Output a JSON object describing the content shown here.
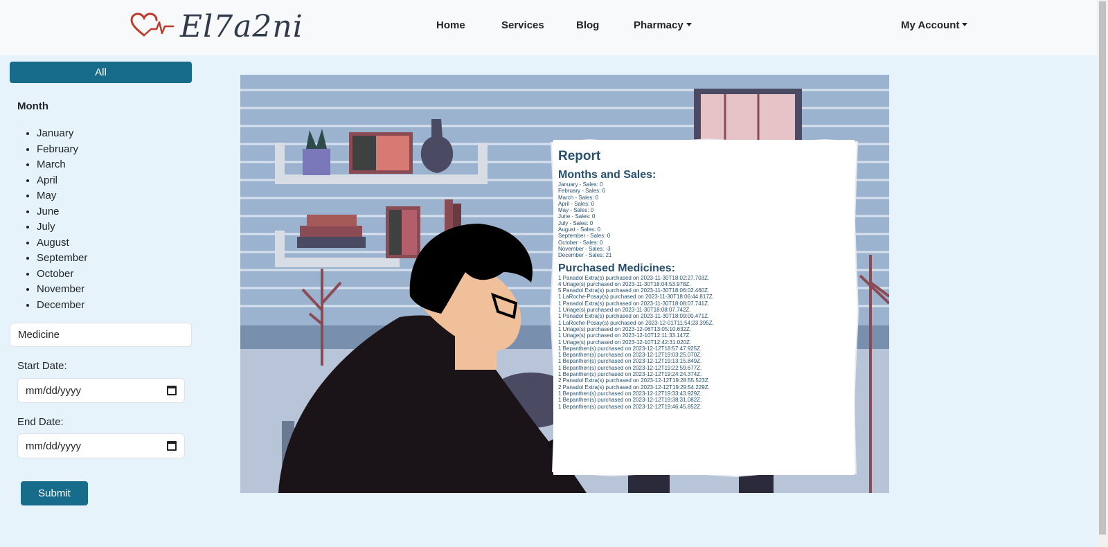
{
  "brand": {
    "name": "El7a2ni",
    "logo_icon": "heart-pulse-icon",
    "logo_color": "#c0392b"
  },
  "nav": {
    "home": "Home",
    "services": "Services",
    "blog": "Blog",
    "pharmacy": "Pharmacy",
    "account": "My Account"
  },
  "sidebar": {
    "all_label": "All",
    "month_heading": "Month",
    "months": [
      "January",
      "February",
      "March",
      "April",
      "May",
      "June",
      "July",
      "August",
      "September",
      "October",
      "November",
      "December"
    ],
    "medicine_placeholder": "Medicine",
    "start_label": "Start Date:",
    "start_placeholder": "mm/dd/yyyy",
    "end_label": "End Date:",
    "end_placeholder": "mm/dd/yyyy",
    "submit_label": "Submit"
  },
  "report": {
    "title": "Report",
    "sales_heading": "Months and Sales:",
    "sales": [
      "January - Sales: 0",
      "February - Sales: 0",
      "March - Sales: 0",
      "April - Sales: 0",
      "May - Sales: 0",
      "June - Sales: 0",
      "July - Sales: 0",
      "August - Sales: 0",
      "September - Sales: 0",
      "October - Sales: 0",
      "November - Sales: -3",
      "December - Sales: 21"
    ],
    "purchases_heading": "Purchased Medicines:",
    "purchases": [
      "1 Panadol Extra(s) purchased on 2023-11-30T18:02:27.703Z.",
      "4 Uriage(s) purchased on 2023-11-30T18:04:53.978Z.",
      "5 Panadol Extra(s) purchased on 2023-11-30T18:06:02.460Z.",
      "1 LaRoche-Posay(s) purchased on 2023-11-30T18:06:44.817Z.",
      "1 Panadol Extra(s) purchased on 2023-11-30T18:08:07.741Z.",
      "1 Uriage(s) purchased on 2023-11-30T18:08:07.742Z.",
      "1 Panadol Extra(s) purchased on 2023-11-30T18:09:00.471Z.",
      "1 LaRoche-Posay(s) purchased on 2023-12-01T11:54:23.395Z.",
      "1 Uriage(s) purchased on 2023-12-06T13:05:10.632Z.",
      "1 Uriage(s) purchased on 2023-12-10T12:11:33.147Z.",
      "1 Uriage(s) purchased on 2023-12-10T12:42:31.020Z.",
      "1 Bepanthen(s) purchased on 2023-12-12T18:57:47.925Z.",
      "1 Bepanthen(s) purchased on 2023-12-12T19:03:25.070Z.",
      "1 Bepanthen(s) purchased on 2023-12-12T19:13:15.849Z.",
      "1 Bepanthen(s) purchased on 2023-12-12T19:22:59.677Z.",
      "1 Bepanthen(s) purchased on 2023-12-12T19:24:24.374Z.",
      "2 Panadol Extra(s) purchased on 2023-12-12T19:28:55.523Z.",
      "2 Panadol Extra(s) purchased on 2023-12-12T19:29:54.229Z.",
      "1 Bepanthen(s) purchased on 2023-12-12T19:33:43.929Z.",
      "1 Bepanthen(s) purchased on 2023-12-12T19:38:31.082Z.",
      "1 Bepanthen(s) purchased on 2023-12-12T19:46:45.852Z."
    ]
  },
  "colors": {
    "accent": "#166c8a",
    "page_bg": "#e6f3fb",
    "report_text": "#25506e"
  }
}
